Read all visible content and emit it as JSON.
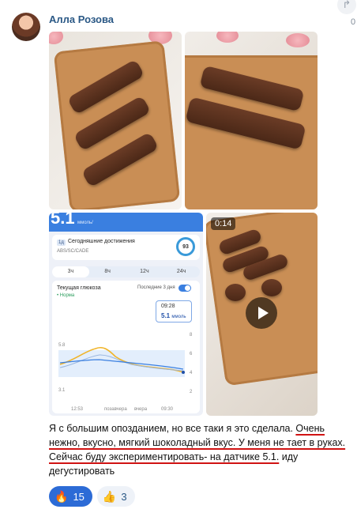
{
  "post": {
    "author": "Алла Розова",
    "side_count": "0",
    "text": {
      "part1": "Я с большим опозданием, но все таки я это сделала. ",
      "part2": "Очень нежно, вкусно, мягкий шоколадный вкус. У меня не тает в руках. Сейчас буду экспериментировать- на датчике 5.1.",
      "part3": " иду дегустировать"
    }
  },
  "media": {
    "video_duration": "0:14",
    "app": {
      "big_value": "5.1",
      "unit": "ммоль/",
      "achievements_badge": "1д",
      "achievements_title": "Сегодняшние достижения",
      "achievements_sub": "ABS/SC/CADE",
      "score": "93",
      "tabs": [
        "3ч",
        "8ч",
        "12ч",
        "24ч"
      ],
      "current_glucose": "Текущая глюкоза",
      "status": "• Норма",
      "last_label": "Последние 3 дня",
      "tip_time": "09:28",
      "tip_value": "5.1",
      "tip_unit": "ммоль",
      "y_ticks": [
        "8",
        "6",
        "4",
        "2"
      ],
      "x_labels": [
        "12:53",
        "позавчера",
        "вчера",
        "09:30"
      ],
      "mark_high": "5.8",
      "mark_low": "3.1"
    }
  },
  "reactions": [
    {
      "icon": "fire-icon",
      "glyph": "🔥",
      "count": "15",
      "active": true
    },
    {
      "icon": "thumbs-up-icon",
      "glyph": "👍",
      "count": "3",
      "active": false
    }
  ],
  "colors": {
    "author": "#2a5885",
    "underline": "#d01313",
    "active_reaction": "#2c6bd6"
  }
}
